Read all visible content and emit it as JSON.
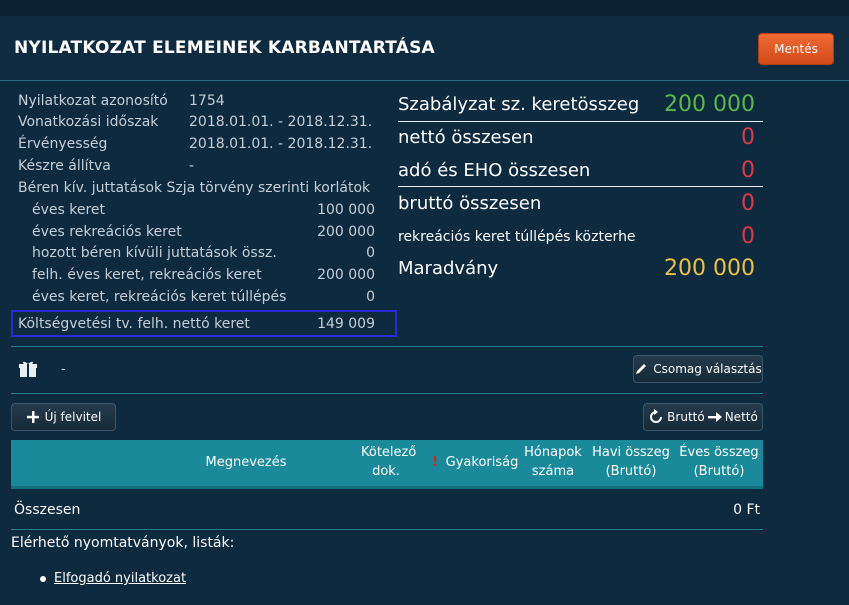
{
  "header": {
    "title": "NYILATKOZAT ELEMEINEK KARBANTARTÁSA",
    "save_label": "Mentés"
  },
  "info": {
    "id_label": "Nyilatkozat azonosító",
    "id_value": "1754",
    "period_label": "Vonatkozási időszak",
    "period_value": "2018.01.01. - 2018.12.31.",
    "validity_label": "Érvényesség",
    "validity_value": "2018.01.01. - 2018.12.31.",
    "created_label": "Készre állítva",
    "created_value": "-",
    "limits_label": "Béren kív. juttatások Szja törvény szerinti korlátok",
    "annual_label": "éves keret",
    "annual_value": "100 000",
    "recreation_label": "éves rekreációs keret",
    "recreation_value": "200 000",
    "brought_label": "hozott béren kívüli juttatások össz.",
    "brought_value": "0",
    "used_label": "felh. éves keret, rekreációs keret",
    "used_value": "200 000",
    "exceed_label": "éves keret, rekreációs keret túllépés",
    "exceed_value": "0",
    "budget_label": "Költségvetési tv. felh. nettó keret",
    "budget_value": "149 009"
  },
  "summary": {
    "rule_label": "Szabályzat sz. keretösszeg",
    "rule_value": "200 000",
    "net_label": "nettó összesen",
    "net_value": "0",
    "tax_label": "adó és EHO összesen",
    "tax_value": "0",
    "gross_label": "bruttó összesen",
    "gross_value": "0",
    "recr_exceed_label": "rekreációs keret túllépés közterhe",
    "recr_exceed_value": "0",
    "remaining_label": "Maradvány",
    "remaining_value": "200 000",
    "colors": {
      "green": "#5db84a",
      "red": "#e0384a",
      "yellow": "#f0c040"
    }
  },
  "package": {
    "value": "-",
    "choose_label": "Csomag választás",
    "icon": "gift-icon"
  },
  "actions": {
    "new_label": "Új felvitel",
    "toggle_label_a": "Bruttó",
    "toggle_label_b": "Nettó"
  },
  "table": {
    "col_name": "Megnevezés",
    "col_req_1": "Kötelező",
    "col_req_2": "dok.",
    "col_freq": "Gyakoriság",
    "col_months_1": "Hónapok",
    "col_months_2": "száma",
    "col_monthly_1": "Havi összeg",
    "col_monthly_2": "(Bruttó)",
    "col_yearly_1": "Éves összeg",
    "col_yearly_2": "(Bruttó)",
    "warn": "!",
    "total_label": "Összesen",
    "total_value": "0 Ft"
  },
  "prints": {
    "title": "Elérhető nyomtatványok, listák:",
    "link": "Elfogadó nyilatkozat"
  }
}
